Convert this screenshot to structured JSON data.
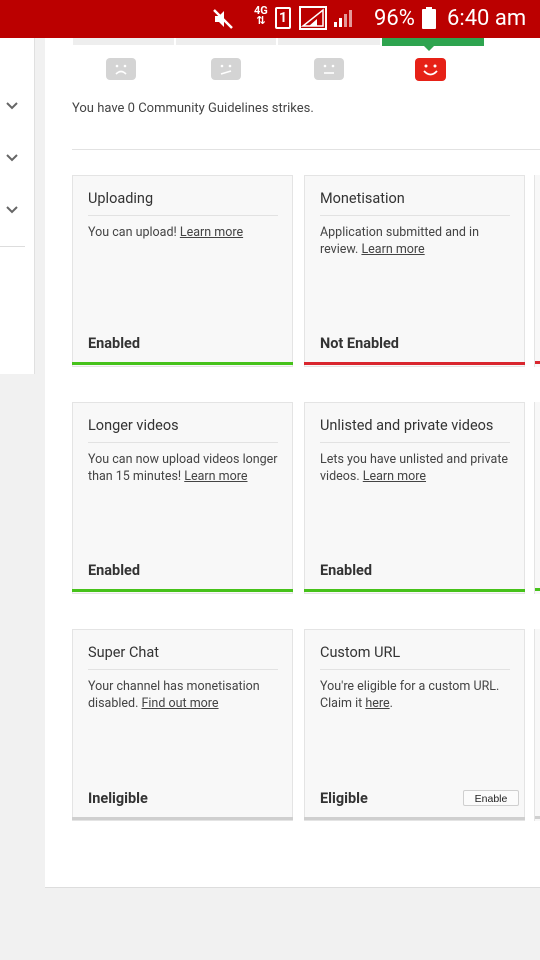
{
  "status_bar": {
    "network": "4G",
    "sim_slot": "1",
    "battery": "96%",
    "time": "6:40 am"
  },
  "strikes_text": "You have 0 Community Guidelines strikes.",
  "cards": [
    {
      "title": "Uploading",
      "desc": "You can upload!",
      "link": "Learn more",
      "status": "Enabled",
      "bar": "green"
    },
    {
      "title": "Monetisation",
      "desc": "Application submitted and in review.",
      "link": "Learn more",
      "status": "Not Enabled",
      "bar": "red"
    },
    {
      "title": "Longer videos",
      "desc": "You can now upload videos longer than 15 minutes!",
      "link": "Learn more",
      "status": "Enabled",
      "bar": "green"
    },
    {
      "title": "Unlisted and private videos",
      "desc": "Lets you have unlisted and private videos.",
      "link": "Learn more",
      "status": "Enabled",
      "bar": "green"
    },
    {
      "title": "Super Chat",
      "desc": "Your channel has monetisation disabled.",
      "link": "Find out more",
      "status": "Ineligible",
      "bar": "grey"
    },
    {
      "title": "Custom URL",
      "desc": "You're eligible for a custom URL. Claim it",
      "link": "here",
      "desc_suffix": ".",
      "status": "Eligible",
      "bar": "grey",
      "button": "Enable"
    }
  ],
  "colors": {
    "status_bar": "#bb0000",
    "green": "#46c21a",
    "red": "#d9262e",
    "active_face": "#e62117"
  }
}
